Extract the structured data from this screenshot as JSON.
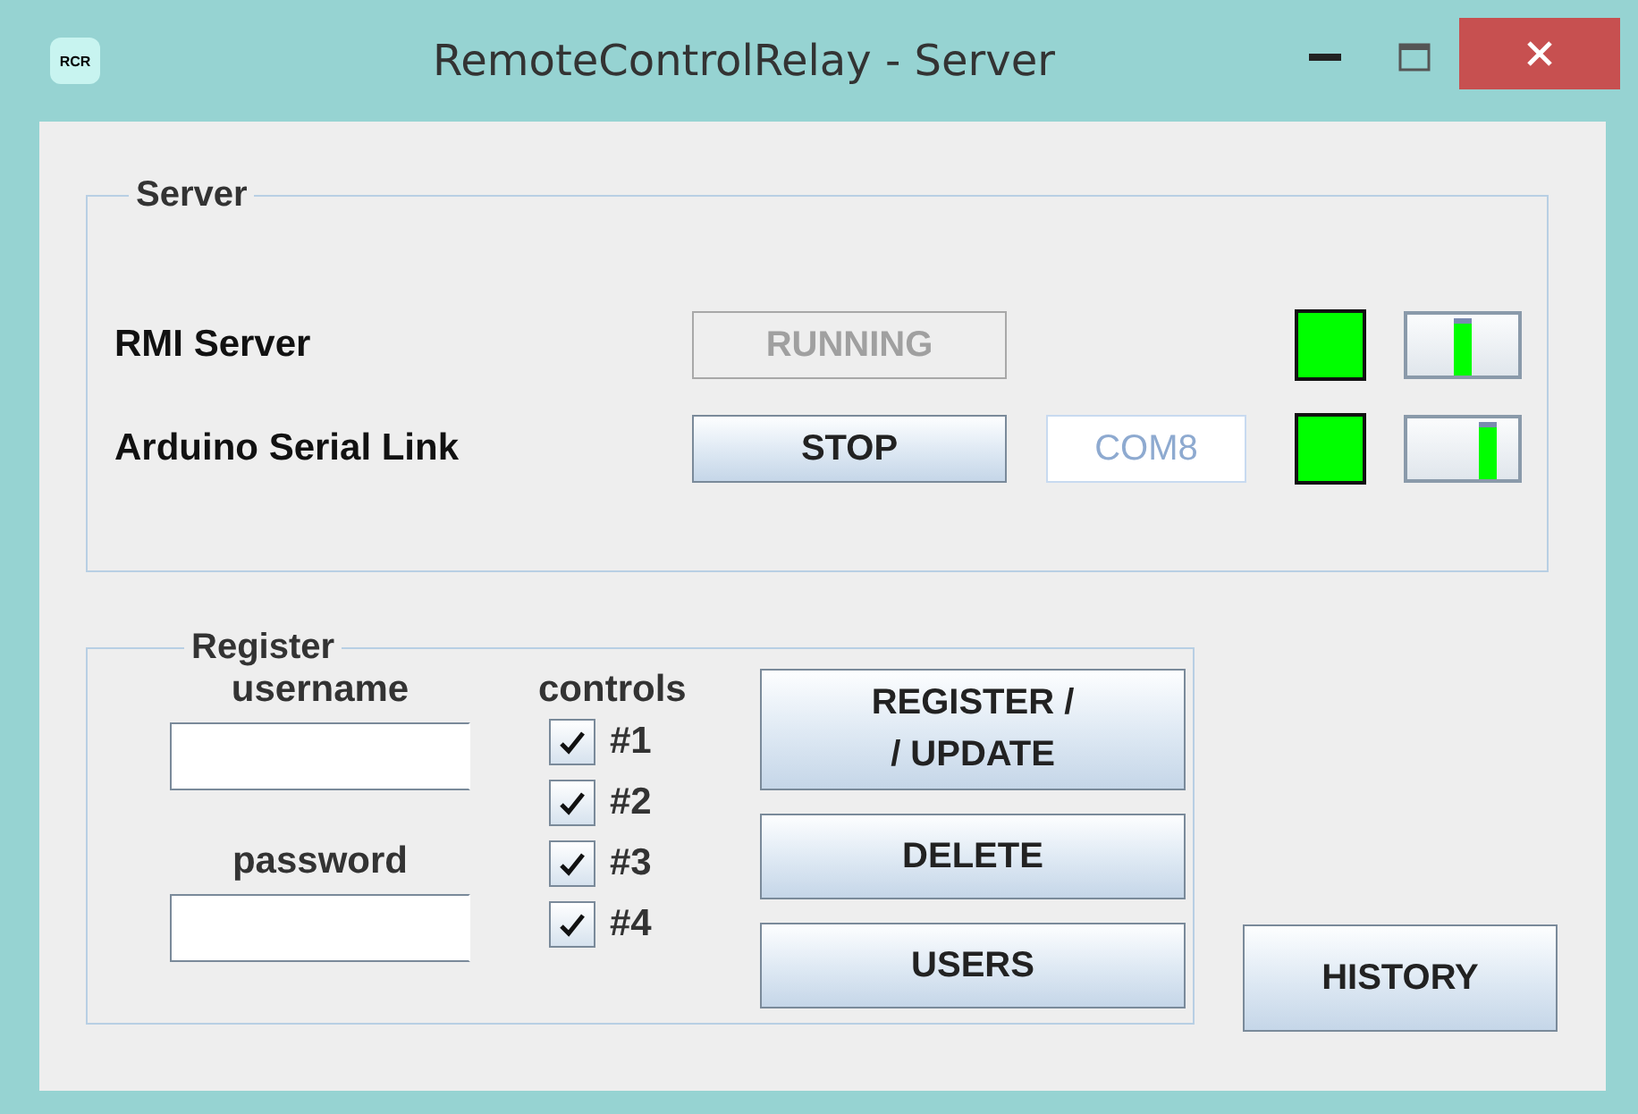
{
  "window": {
    "title": "RemoteControlRelay - Server",
    "icon_text": "RCR"
  },
  "server": {
    "title": "Server",
    "rows": [
      {
        "label": "RMI Server",
        "button": {
          "label": "RUNNING",
          "disabled": true
        },
        "indicator": {
          "color": "#00ff00"
        },
        "slider": {
          "level": 0.5
        }
      },
      {
        "label": "Arduino Serial Link",
        "button": {
          "label": "STOP",
          "disabled": false
        },
        "port": {
          "value": "COM8",
          "disabled": true
        },
        "indicator": {
          "color": "#00ff00"
        },
        "slider": {
          "level": 0.73
        }
      }
    ]
  },
  "register": {
    "title": "Register",
    "username": {
      "label": "username"
    },
    "password": {
      "label": "password"
    },
    "controls": {
      "label": "controls",
      "items": [
        {
          "label": "#1",
          "checked": true
        },
        {
          "label": "#2",
          "checked": true
        },
        {
          "label": "#3",
          "checked": true
        },
        {
          "label": "#4",
          "checked": true
        }
      ]
    },
    "buttons": [
      {
        "label": "REGISTER /\n/ UPDATE"
      },
      {
        "label": "DELETE"
      },
      {
        "label": "USERS"
      }
    ]
  },
  "history_button": {
    "label": "HISTORY"
  }
}
